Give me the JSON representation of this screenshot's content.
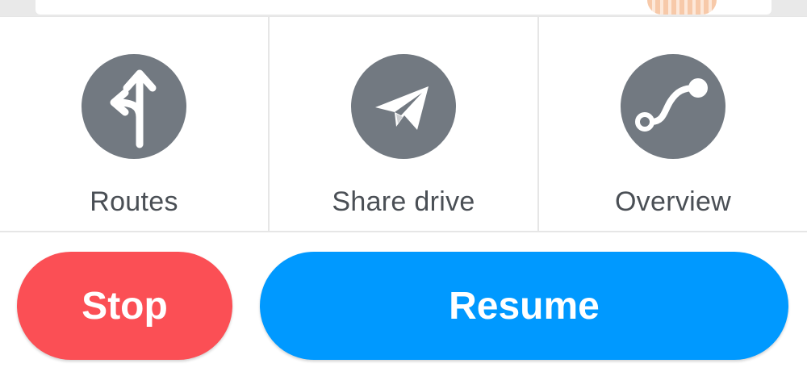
{
  "colors": {
    "icon_circle": "#727981",
    "label_text": "#4a4f55",
    "stop_button": "#fb4f55",
    "resume_button": "#0099ff",
    "divider": "#e6e6e6"
  },
  "actions": [
    {
      "label": "Routes",
      "icon": "routes-fork-icon"
    },
    {
      "label": "Share drive",
      "icon": "paper-plane-icon"
    },
    {
      "label": "Overview",
      "icon": "route-overview-icon"
    }
  ],
  "buttons": {
    "stop_label": "Stop",
    "resume_label": "Resume"
  }
}
